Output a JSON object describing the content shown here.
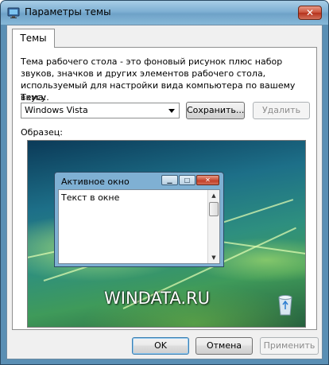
{
  "window": {
    "title": "Параметры темы",
    "close_glyph": "✕"
  },
  "tabs": [
    {
      "label": "Темы",
      "selected": true
    }
  ],
  "panel": {
    "description": "Тема рабочего стола - это фоновый рисунок плюс набор звуков, значков и других элементов рабочего стола, используемый для настройки вида компьютера по вашему вкусу.",
    "theme_label": "Тема:",
    "theme_value": "Windows Vista",
    "save_label": "Сохранить...",
    "delete_label": "Удалить",
    "sample_label": "Образец:"
  },
  "preview": {
    "window_title": "Активное окно",
    "window_text": "Текст в окне",
    "watermark": "WINDATA.RU"
  },
  "footer": {
    "ok_label": "OK",
    "cancel_label": "Отмена",
    "apply_label": "Применить"
  },
  "colors": {
    "titlebar": "#7fb0d3",
    "close_button": "#c9513a",
    "dialog_bg": "#f0f0f0",
    "wallpaper": "#2e8f7f"
  },
  "icons": [
    "display-settings-icon",
    "close-icon",
    "minimize-icon",
    "maximize-icon",
    "recycle-bin-icon",
    "dropdown-arrow-icon"
  ]
}
